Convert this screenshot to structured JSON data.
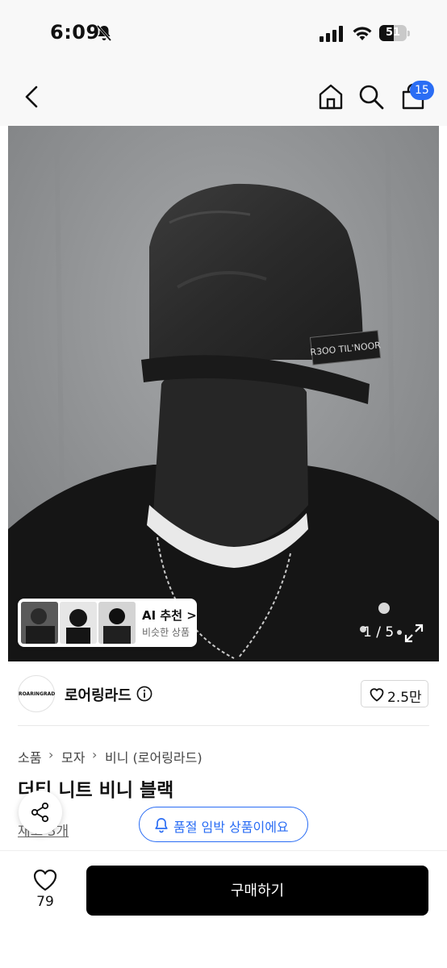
{
  "status_bar": {
    "time": "6:09",
    "battery": "51"
  },
  "nav": {
    "cart_count": "15"
  },
  "gallery": {
    "counter": "1 / 5",
    "hat_label": "R3OO TIL'NOOR",
    "ai_card": {
      "title": "AI 추천 >",
      "subtitle": "비슷한 상품"
    }
  },
  "brand": {
    "logo_text": "ROARINGRAD",
    "name": "로어링라드",
    "likes": "2.5만"
  },
  "breadcrumb": [
    "소품",
    "모자",
    "비니 (로어링라드)"
  ],
  "product": {
    "title": "더티 니트 비니 블랙",
    "stock": "재고 3개"
  },
  "notice": {
    "label": "품절 임박 상품이에요"
  },
  "bottom": {
    "wish_count": "79",
    "buy_label": "구매하기"
  },
  "colors": {
    "accent": "#2a6df4",
    "buy_bg": "#000000"
  }
}
